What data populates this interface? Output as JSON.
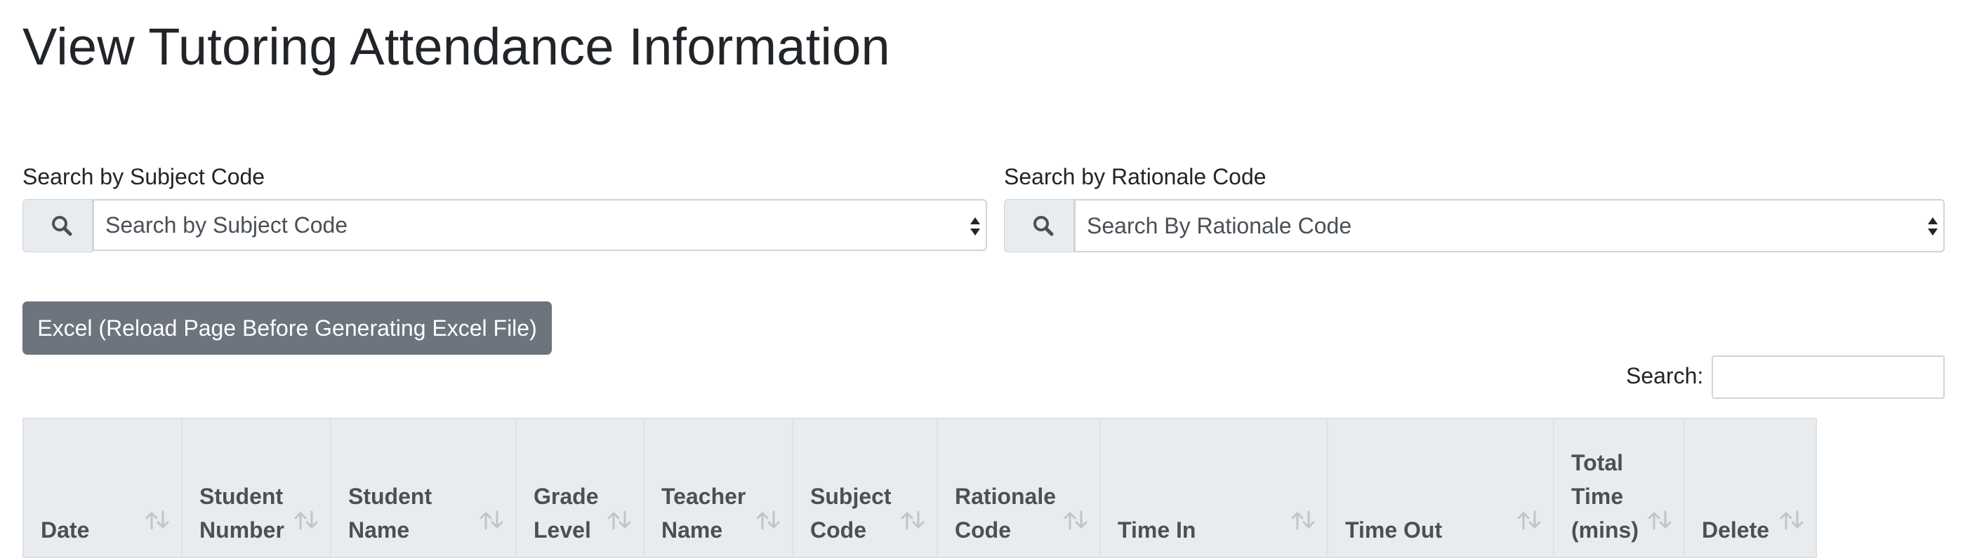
{
  "page": {
    "title": "View Tutoring Attendance Information"
  },
  "filters": {
    "subject": {
      "label": "Search by Subject Code",
      "placeholder": "Search by Subject Code",
      "search_icon": "search-icon",
      "arrow_icon": "select-arrows-icon"
    },
    "rationale": {
      "label": "Search by Rationale Code",
      "placeholder": "Search By Rationale Code",
      "search_icon": "search-icon",
      "arrow_icon": "select-arrows-icon"
    }
  },
  "toolbar": {
    "excel_label": "Excel (Reload Page Before Generating Excel File)"
  },
  "table_search": {
    "label": "Search:",
    "value": ""
  },
  "table": {
    "sort_icon": "sort-arrows-icon",
    "columns": [
      {
        "label": "Date"
      },
      {
        "label": "Student Number"
      },
      {
        "label": "Student Name"
      },
      {
        "label": "Grade Level"
      },
      {
        "label": "Teacher Name"
      },
      {
        "label": "Subject Code"
      },
      {
        "label": "Rationale Code"
      },
      {
        "label": "Time In"
      },
      {
        "label": "Time Out"
      },
      {
        "label": "Total Time (mins)"
      },
      {
        "label": "Delete"
      }
    ]
  },
  "colors": {
    "button_bg": "#6c757d",
    "header_bg": "#e9ecef",
    "border": "#ced4da",
    "text": "#212529"
  }
}
